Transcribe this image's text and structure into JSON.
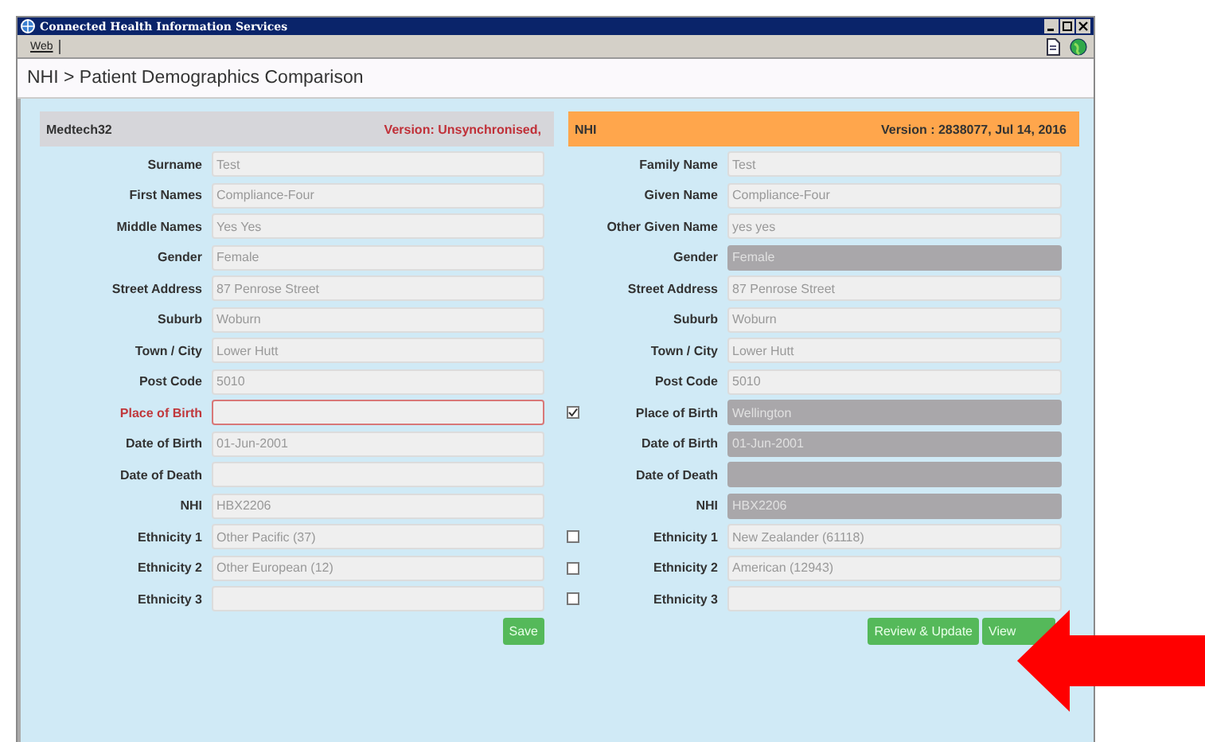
{
  "window": {
    "title": "Connected Health Information Services"
  },
  "toolbar": {
    "tabs": [
      {
        "label": "Web",
        "selected": true
      }
    ]
  },
  "breadcrumb": "NHI > Patient Demographics Comparison",
  "local": {
    "source": "Medtech32",
    "version": "Version: Unsynchronised,"
  },
  "nhi": {
    "source": "NHI",
    "version": "Version : 2838077, Jul 14, 2016"
  },
  "rows": [
    {
      "left": {
        "label": "Surname",
        "value": "Test",
        "invalid": false
      },
      "right": {
        "label": "Family Name",
        "value": "Test",
        "locked": false
      }
    },
    {
      "left": {
        "label": "First Names",
        "value": "Compliance-Four",
        "invalid": false
      },
      "right": {
        "label": "Given Name",
        "value": "Compliance-Four",
        "locked": false
      }
    },
    {
      "left": {
        "label": "Middle Names",
        "value": "Yes Yes",
        "invalid": false
      },
      "right": {
        "label": "Other Given Name",
        "value": "yes yes",
        "locked": false
      }
    },
    {
      "left": {
        "label": "Gender",
        "value": "Female",
        "invalid": false
      },
      "right": {
        "label": "Gender",
        "value": "Female",
        "locked": true
      }
    },
    {
      "left": {
        "label": "Street Address",
        "value": "87 Penrose Street",
        "invalid": false
      },
      "right": {
        "label": "Street Address",
        "value": "87 Penrose Street",
        "locked": false
      }
    },
    {
      "left": {
        "label": "Suburb",
        "value": "Woburn",
        "invalid": false
      },
      "right": {
        "label": "Suburb",
        "value": "Woburn",
        "locked": false
      }
    },
    {
      "left": {
        "label": "Town / City",
        "value": "Lower Hutt",
        "invalid": false
      },
      "right": {
        "label": "Town / City",
        "value": "Lower Hutt",
        "locked": false
      }
    },
    {
      "left": {
        "label": "Post Code",
        "value": "5010",
        "invalid": false
      },
      "right": {
        "label": "Post Code",
        "value": "5010",
        "locked": false
      }
    },
    {
      "left": {
        "label": "Place of Birth",
        "invalid": true
      },
      "checkbox": {
        "checked": true
      },
      "right": {
        "label": "Place of Birth",
        "value": "Wellington",
        "locked": true
      }
    },
    {
      "left": {
        "label": "Date of Birth",
        "value": "01-Jun-2001",
        "invalid": false
      },
      "right": {
        "label": "Date of Birth",
        "value": "01-Jun-2001",
        "locked": true
      }
    },
    {
      "left": {
        "label": "Date of Death",
        "invalid": false
      },
      "right": {
        "label": "Date of Death",
        "locked": true
      }
    },
    {
      "left": {
        "label": "NHI",
        "value": "HBX2206",
        "invalid": false
      },
      "right": {
        "label": "NHI",
        "value": "HBX2206",
        "locked": true
      }
    },
    {
      "left": {
        "label": "Ethnicity 1",
        "value": "Other Pacific (37)",
        "invalid": false
      },
      "checkbox": {
        "checked": false
      },
      "right": {
        "label": "Ethnicity 1",
        "value": "New Zealander (61118)",
        "locked": false
      }
    },
    {
      "left": {
        "label": "Ethnicity 2",
        "value": "Other European (12)",
        "invalid": false
      },
      "checkbox": {
        "checked": false
      },
      "right": {
        "label": "Ethnicity 2",
        "value": "American (12943)",
        "locked": false
      }
    },
    {
      "left": {
        "label": "Ethnicity 3",
        "invalid": false
      },
      "checkbox": {
        "checked": false
      },
      "right": {
        "label": "Ethnicity 3",
        "locked": false
      }
    }
  ],
  "buttons": {
    "left": [
      {
        "label": "Save"
      }
    ],
    "right": [
      {
        "label": "Review & Update"
      },
      {
        "label": "View"
      }
    ]
  }
}
